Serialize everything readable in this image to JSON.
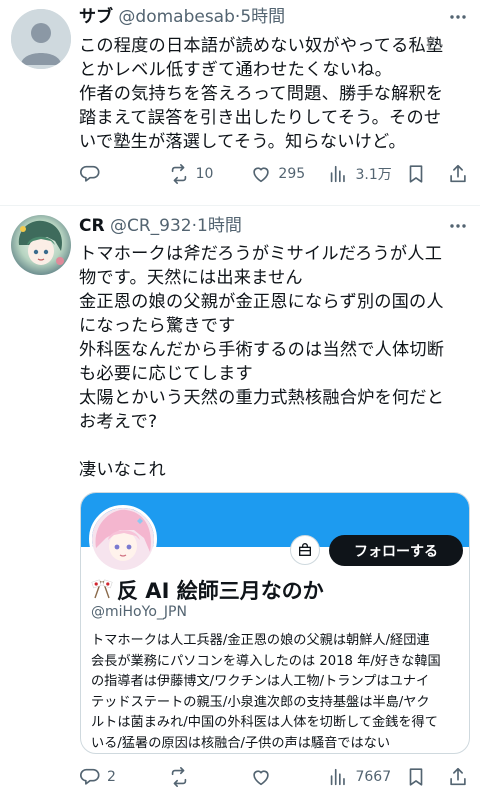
{
  "tweet1": {
    "display_name": "サブ",
    "handle": "@domabesab",
    "separator": "·",
    "time": "5時間",
    "text": "この程度の日本語が読めない奴がやってる私塾\nとかレベル低すぎて通わせたくないね。\n作者の気持ちを答えろって問題、勝手な解釈を\n踏まえて誤答を引き出したりしてそう。そのせ\nいで塾生が落選してそう。知らないけど。",
    "more_icon": "more-horizontal-icon",
    "actions": {
      "reply_count": "",
      "retweet_count": "10",
      "like_count": "295",
      "views_count": "3.1万"
    }
  },
  "tweet2": {
    "display_name": "CR",
    "handle": "@CR_932",
    "separator": "·",
    "time": "1時間",
    "text": "トマホークは斧だろうがミサイルだろうが人工\n物です。天然には出来ません\n金正恩の娘の父親が金正恩にならず別の国の人\nになったら驚きです\n外科医なんだから手術するのは当然で人体切断\nも必要に応じてします\n太陽とかいう天然の重力式熱核融合炉を何だと\nお考えで?\n\n凄いなこれ",
    "more_icon": "more-horizontal-icon",
    "actions": {
      "reply_count": "2",
      "retweet_count": "",
      "like_count": "",
      "views_count": "7667"
    }
  },
  "card": {
    "follow_label": "フォローする",
    "name": "反 AI 絵師三月なのか",
    "handle": "@miHoYo_JPN",
    "bio": "トマホークは人工兵器/金正恩の娘の父親は朝鮮人/経団連\n会長が業務にパソコンを導入したのは 2018 年/好きな韓国\nの指導者は伊藤博文/ワクチンは人工物/トランプはユナイ\nテッドステートの親玉/小泉進次郎の支持基盤は半島/ヤク\nルトは菌まみれ/中国の外科医は人体を切断して金銭を得て\nいる/猛暑の原因は核融合/子供の声は騒音ではない",
    "banner_color": "#1d9bf0"
  },
  "colors": {
    "text": "#0f1419",
    "secondary": "#536471",
    "border": "#cfd9de"
  }
}
